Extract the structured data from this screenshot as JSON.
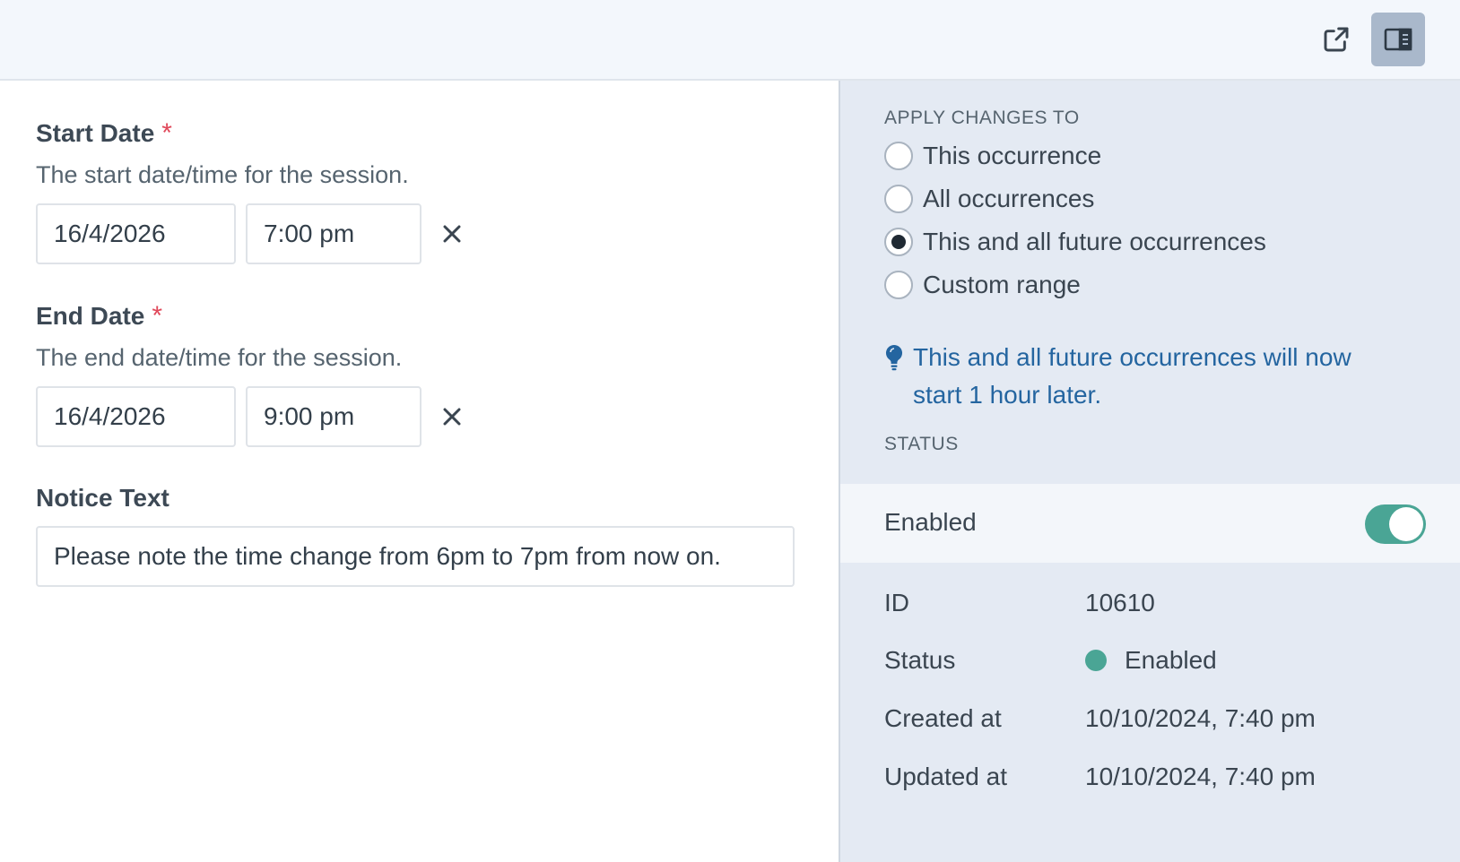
{
  "topbar": {
    "open_external_icon": "external-link-icon",
    "toggle_sidebar_icon": "sidebar-panel-icon"
  },
  "form": {
    "start_date": {
      "label": "Start Date",
      "required_mark": "*",
      "description": "The start date/time for the session.",
      "date_value": "16/4/2026",
      "time_value": "7:00 pm",
      "clear_icon": "close-icon"
    },
    "end_date": {
      "label": "End Date",
      "required_mark": "*",
      "description": "The end date/time for the session.",
      "date_value": "16/4/2026",
      "time_value": "9:00 pm",
      "clear_icon": "close-icon"
    },
    "notice_text": {
      "label": "Notice Text",
      "value": "Please note the time change from 6pm to 7pm from now on."
    }
  },
  "sidebar": {
    "apply_heading": "APPLY CHANGES TO",
    "options": [
      {
        "label": "This occurrence",
        "checked": false
      },
      {
        "label": "All occurrences",
        "checked": false
      },
      {
        "label": "This and all future occurrences",
        "checked": true
      },
      {
        "label": "Custom range",
        "checked": false
      }
    ],
    "notice": "This and all future occurrences will now start 1 hour later.",
    "notice_icon": "lightbulb-icon",
    "status_heading": "STATUS",
    "enabled_label": "Enabled",
    "enabled": true,
    "meta": {
      "id_label": "ID",
      "id_value": "10610",
      "status_label": "Status",
      "status_value": "Enabled",
      "created_label": "Created at",
      "created_value": "10/10/2024, 7:40 pm",
      "updated_label": "Updated at",
      "updated_value": "10/10/2024, 7:40 pm"
    }
  },
  "colors": {
    "accent_green": "#4aa595",
    "required_red": "#e0485a",
    "info_blue": "#2465a0"
  }
}
